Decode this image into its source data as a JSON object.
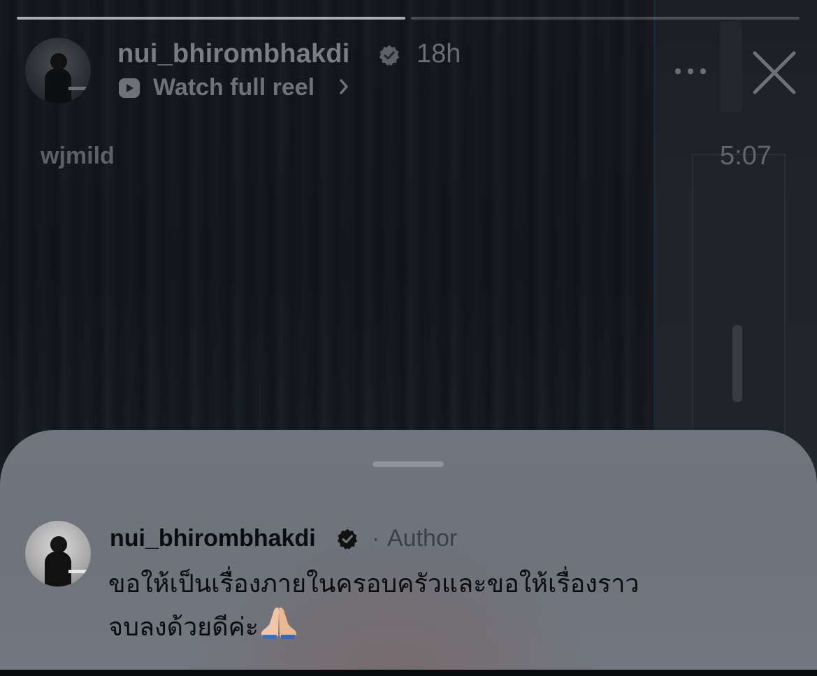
{
  "progress": {
    "segments": [
      {
        "label": "story-segment-1",
        "fill": 1.0
      },
      {
        "label": "story-segment-2",
        "fill": 0.0
      }
    ]
  },
  "header": {
    "username": "nui_bhirombhakdi",
    "time_ago": "18h",
    "watch_full_reel": "Watch full reel",
    "icons": [
      "verified-badge-icon",
      "reel-play-icon",
      "chevron-right-icon",
      "more-icon",
      "close-icon"
    ]
  },
  "video_overlay": {
    "watermark": "wjmild",
    "clock": "5:07"
  },
  "comment": {
    "username": "nui_bhirombhakdi",
    "separator": "·",
    "author_label": "Author",
    "line1": "ขอให้เป็นเรื่องภายในครอบครัวและขอให้เรื่องราว",
    "line2": "จบลงด้วยดีค่ะ",
    "emoji": "folded-hands-icon"
  },
  "colors": {
    "sheet_bg": "#6f757e",
    "text_dark": "#0b0c0e",
    "verified_badge": "#111111"
  }
}
